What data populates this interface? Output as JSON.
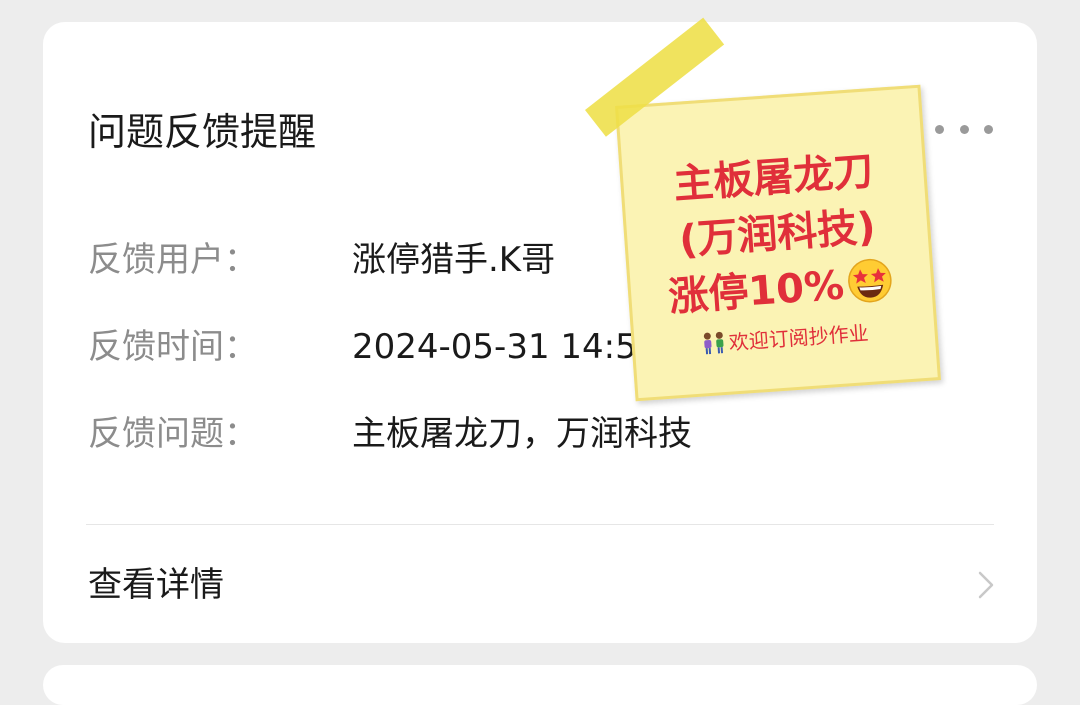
{
  "card": {
    "title": "问题反馈提醒",
    "fields": [
      {
        "label": "反馈用户：",
        "value": "涨停猎手.K哥"
      },
      {
        "label": "反馈时间：",
        "value": "2024-05-31 14:57:30"
      },
      {
        "label": "反馈问题：",
        "value": "主板屠龙刀，万润科技"
      }
    ],
    "detail_label": "查看详情"
  },
  "sticky_note": {
    "line1": "主板屠龙刀",
    "line2": "(万润科技)",
    "line3": "涨停10%",
    "footer": "欢迎订阅抄作业",
    "emoji": "star-struck-emoji-icon",
    "footer_icon": "people-icon"
  },
  "colors": {
    "background": "#ededed",
    "card": "#ffffff",
    "label": "#8c8c8c",
    "text": "#1a1a1a",
    "note_text": "#e02f3a",
    "note_bg": "#fbf3b4",
    "tape": "#eedf48"
  }
}
